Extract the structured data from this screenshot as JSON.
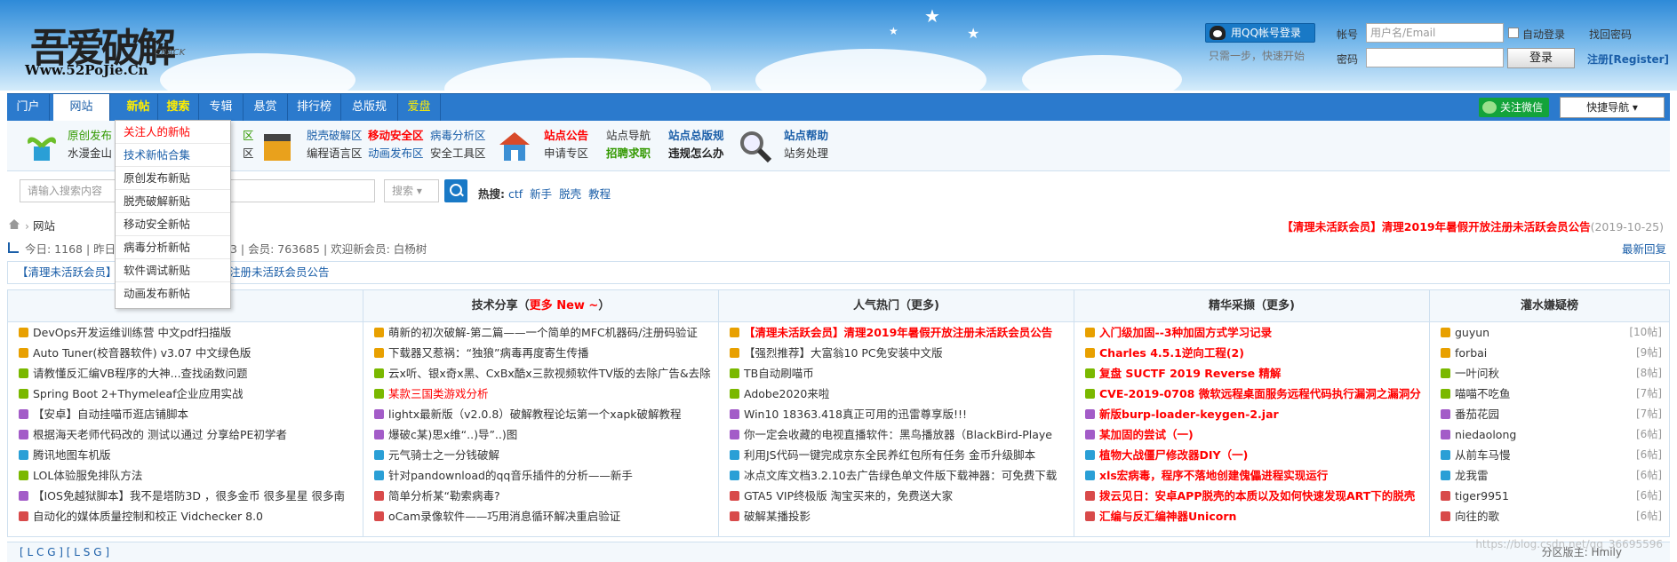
{
  "header": {
    "logo_cn": "吾爱破解",
    "logo_crack": "CRACK",
    "logo_url": "Www.52PoJie.Cn",
    "qq_login": "用QQ帐号登录",
    "qq_hint": "只需一步，快速开始",
    "account_label": "帐号",
    "account_placeholder": "用户名/Email",
    "auto_login": "自动登录",
    "find_password": "找回密码",
    "password_label": "密码",
    "login_button": "登录",
    "register": "注册[Register]"
  },
  "nav": {
    "items": [
      "门户",
      "网站",
      "新帖",
      "搜索",
      "专辑",
      "悬赏",
      "排行榜",
      "总版规",
      "爱盘"
    ],
    "wechat": "关注微信",
    "quick": "快捷导航 ▾"
  },
  "dropdown": [
    "关注人的新帖",
    "技术新帖合集",
    "原创发布新贴",
    "脱壳破解新贴",
    "移动安全新帖",
    "病毒分析新帖",
    "软件调试新贴",
    "动画发布新帖"
  ],
  "subnav": {
    "col1": [
      "原创发布",
      "水漫金山"
    ],
    "col1b": [
      "区",
      "区"
    ],
    "col3a": [
      "脱壳破解区",
      "编程语言区"
    ],
    "col3b": [
      "移动安全区",
      "动画发布区"
    ],
    "col3c": [
      "病毒分析区",
      "安全工具区"
    ],
    "col4a": [
      "站点公告",
      "申请专区"
    ],
    "col4b": [
      "站点导航",
      "招聘求职"
    ],
    "col4c": [
      "站点总版规",
      "违规怎么办"
    ],
    "col5": [
      "站点帮助",
      "站务处理"
    ]
  },
  "search": {
    "placeholder": "请输入搜索内容",
    "select": "搜索 ▾",
    "hot_label": "热搜:",
    "hot": [
      "ctf",
      "新手",
      "脱壳",
      "教程"
    ]
  },
  "crumb": "网站",
  "notice": {
    "text": "【清理未活跃会员】清理2019年暑假开放注册未活跃会员公告",
    "date": "(2019-10-25)"
  },
  "stats": {
    "text": "今日: 1168 | 昨日",
    "rest": "53 | 会员: 763685 | 欢迎新会员: 白杨树",
    "latest": "最新回复"
  },
  "board": "【清理未活跃会员】",
  "board_rest": "注册未活跃会员公告",
  "columns": [
    {
      "title": "",
      "items": [
        "DevOps开发运维训练营 中文pdf扫描版",
        "Auto Tuner(校音器软件) v3.07 中文绿色版",
        "请教懂反汇编VB程序的大神...查找函数问题",
        "Spring Boot 2+Thymeleaf企业应用实战",
        "【安卓】自动挂喵币逛店铺脚本",
        "根据海天老师代码改的 测试以通过 分享给PE初学者",
        "腾讯地图车机版",
        "LOL体验服免排队方法",
        "【IOS免越狱脚本】我不是塔防3D ，很多金币 很多星星 很多南",
        "自动化的媒体质量控制和校正 Vidchecker 8.0"
      ]
    },
    {
      "title": "技术分享",
      "title_red": "更多 New ~",
      "items": [
        "萌新的初次破解-第二篇——一个简单的MFC机器码/注册码验证",
        "下载器又惹祸：“独狼”病毒再度寄生传播",
        "云x听、银x奇x黑、CxBx酷x三款视频软件TV版的去除广告&去除",
        "某款三国类游戏分析",
        "lightx最新版（v2.0.8）破解教程论坛第一个xapk破解教程",
        "爆破c某)思x维“..)导”..)图",
        "元气骑士之一分钱破解",
        "针对pandownload的qq音乐插件的分析——新手",
        "简单分析某“勒索病毒?",
        "oCam录像软件——巧用消息循环解决重启验证"
      ]
    },
    {
      "title": "人气热门（更多)",
      "items": [
        "【清理未活跃会员】清理2019年暑假开放注册未活跃会员公告",
        "【强烈推荐】大富翁10 PC免安装中文版",
        "TB自动刷喵币",
        "Adobe2020来啦",
        "Win10 18363.418真正可用的迅雷尊享版!!!",
        "你一定会收藏的电视直播软件：黑鸟播放器（BlackBird-Playe",
        "利用JS代码一键完成京东全民养红包所有任务 金币升级脚本",
        "冰点文库文档3.2.10去广告绿色单文件版下载神器：可免费下载",
        "GTA5 VIP终极版 淘宝买来的，免费送大家",
        "破解某播投影"
      ]
    },
    {
      "title": "精华采撷（更多)",
      "items": [
        "入门级加固--3种加固方式学习记录",
        "Charles 4.5.1逆向工程(2)",
        "复盘 SUCTF 2019 Reverse 精解",
        "CVE-2019-0708 微软远程桌面服务远程代码执行漏洞之漏洞分",
        "新版burp-loader-keygen-2.jar",
        "某加固的尝试（一)",
        "植物大战僵尸修改器DIY（一)",
        "xls宏病毒，程序不落地创建傀儡进程实现运行",
        "拨云见日：安卓APP脱壳的本质以及如何快速发现ART下的脱壳",
        "汇编与反汇编神器Unicorn"
      ]
    },
    {
      "title": "灌水嫌疑榜",
      "items": [
        "guyun",
        "forbai",
        "一叶问秋",
        "喵喵不吃鱼",
        "番茄花园",
        "niedaolong",
        "从前车马慢",
        "龙我雷",
        "tiger9951",
        "向往的歌"
      ],
      "counts": [
        "[10帖]",
        "[9帖]",
        "[8帖]",
        "[7帖]",
        "[7帖]",
        "[6帖]",
        "[6帖]",
        "[6帖]",
        "[6帖]",
        "[6帖]"
      ]
    }
  ],
  "footer": "[ L C G ]  [ L S G ]",
  "footer_right": "分区版主: Hmily",
  "watermark": "https://blog.csdn.net/qq_36695596"
}
